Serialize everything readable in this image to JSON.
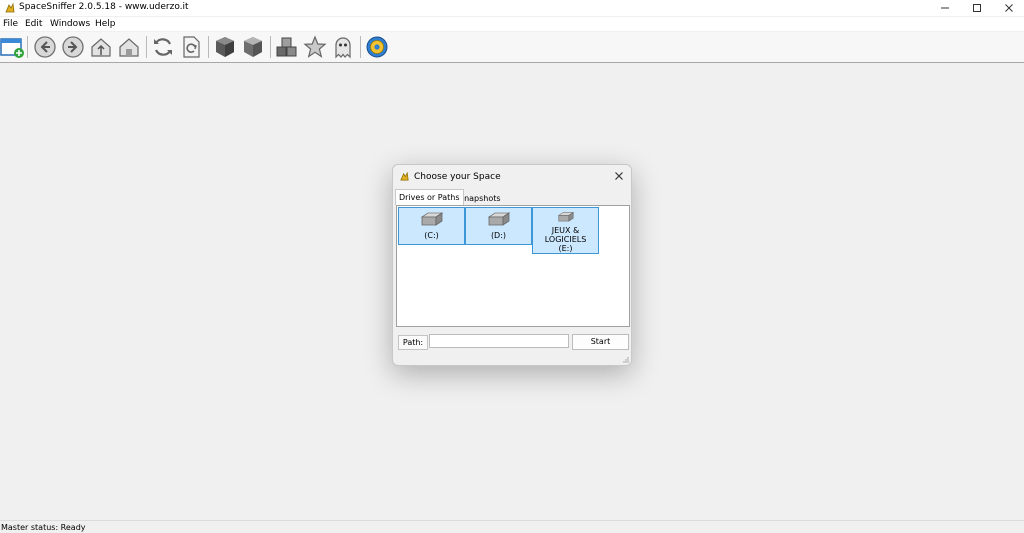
{
  "window": {
    "title": "SpaceSniffer 2.0.5.18 - www.uderzo.it"
  },
  "menu": {
    "items": [
      "File",
      "Edit",
      "Windows",
      "Help"
    ]
  },
  "toolbar": {
    "buttons": [
      {
        "icon": "new-window-icon"
      },
      {
        "icon": "back-arrow-icon"
      },
      {
        "icon": "forward-arrow-icon"
      },
      {
        "icon": "up-home-icon"
      },
      {
        "icon": "home-icon"
      },
      {
        "icon": "refresh-icon"
      },
      {
        "icon": "refresh-document-icon"
      },
      {
        "icon": "cube-dark-icon"
      },
      {
        "icon": "cube-light-icon"
      },
      {
        "icon": "cubes-icon"
      },
      {
        "icon": "star-icon"
      },
      {
        "icon": "ghost-icon"
      },
      {
        "icon": "gear-icon"
      }
    ]
  },
  "dialog": {
    "title": "Choose your Space",
    "tabs": [
      "Drives or Paths",
      "Snapshots"
    ],
    "drives": [
      {
        "label": "(C:)"
      },
      {
        "label": "(D:)"
      },
      {
        "label": "JEUX & LOGICIELS\n(E:)"
      }
    ],
    "path_label": "Path:",
    "path_value": "",
    "start_label": "Start"
  },
  "status": {
    "text": "Master status: Ready"
  },
  "colors": {
    "drive_selected_bg": "#cce8ff",
    "drive_selected_border": "#3d96d6",
    "background": "#f0f0f0"
  }
}
